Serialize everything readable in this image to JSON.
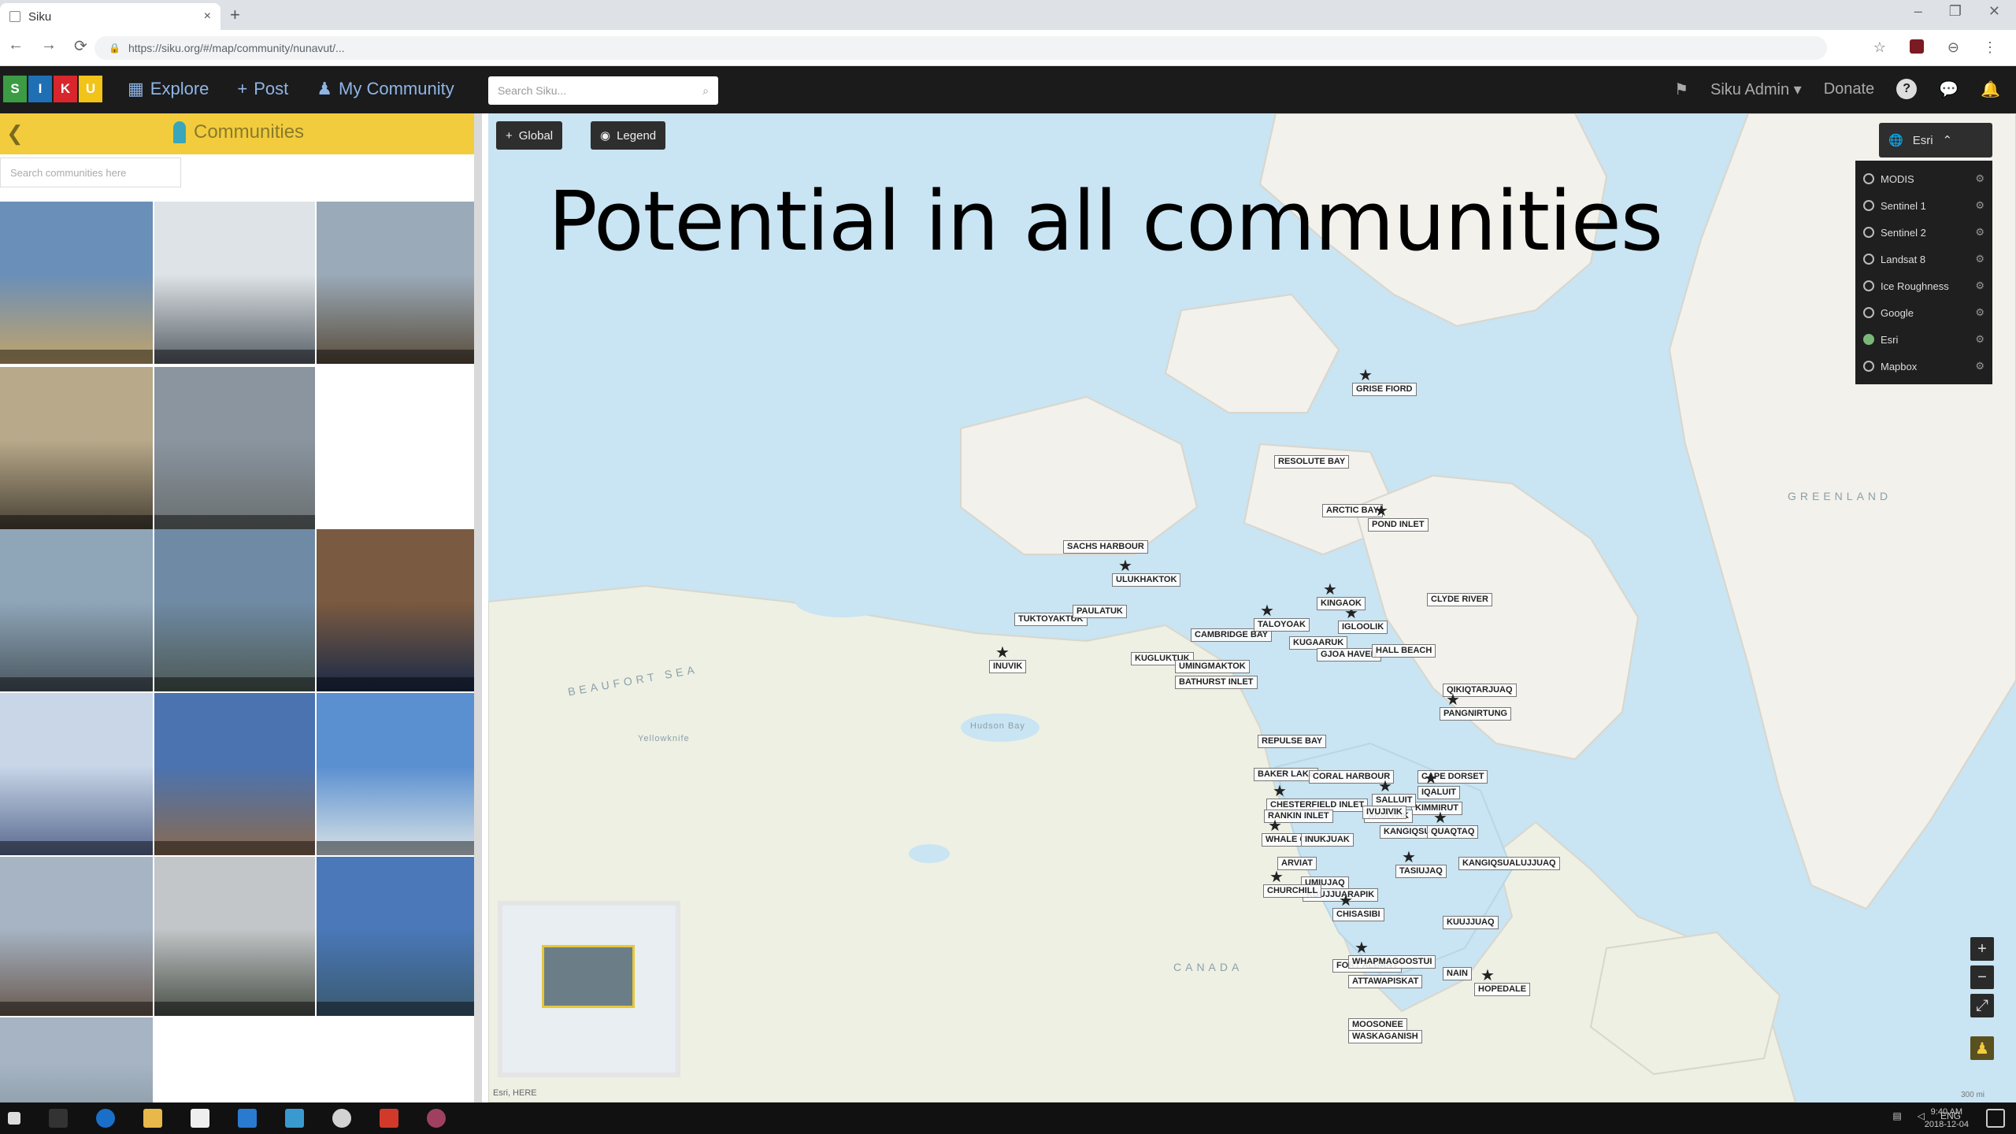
{
  "browser": {
    "tab_title": "Siku",
    "new_tab": "+",
    "tab_close": "×",
    "url": "https://siku.org/#/map/community/nunavut/...",
    "window_controls": [
      "–",
      "❐",
      "✕"
    ],
    "nav": [
      "←",
      "→",
      "⟳"
    ]
  },
  "app": {
    "logo_letters": [
      "S",
      "I",
      "K",
      "U"
    ],
    "logo_colors": [
      "#3b9c44",
      "#1f6fb5",
      "#d8262c",
      "#f2c318"
    ],
    "nav": [
      {
        "label": "Explore",
        "icon": "grid-icon"
      },
      {
        "label": "Post",
        "icon": "plus-icon"
      },
      {
        "label": "My Community",
        "icon": "person-icon"
      }
    ],
    "search_placeholder": "Search Siku...",
    "user": "Siku Admin",
    "donate": "Donate",
    "icons": [
      "help-icon",
      "chat-icon",
      "bell-icon"
    ]
  },
  "panel": {
    "title": "Communities",
    "back": "❮",
    "search_placeholder": "Search communities here",
    "tiles": [
      {
        "colors": [
          "#6a8fb8",
          "#c2a36a"
        ]
      },
      {
        "colors": [
          "#dde3e6",
          "#596068"
        ]
      },
      {
        "colors": [
          "#9aaab8",
          "#5a4d3c"
        ]
      },
      {
        "colors": [
          "#b8a98a",
          "#4a4236"
        ]
      },
      {
        "colors": [
          "#8a95a0",
          "#6a6f70"
        ]
      },
      {
        "colors": [
          "#ffffff",
          "#ffffff"
        ]
      },
      {
        "colors": [
          "#8fa5b8",
          "#4a5860"
        ]
      },
      {
        "colors": [
          "#6f8aa4",
          "#4d5a55"
        ]
      },
      {
        "colors": [
          "#7a5a40",
          "#1a2a48"
        ]
      },
      {
        "colors": [
          "#c8d6e8",
          "#5a6a90"
        ]
      },
      {
        "colors": [
          "#4a73b0",
          "#8a6a50"
        ]
      },
      {
        "colors": [
          "#5a8fd0",
          "#d8e2e6"
        ]
      },
      {
        "colors": [
          "#a6b4c4",
          "#6a5a50"
        ]
      },
      {
        "colors": [
          "#c2c6c8",
          "#4a5048"
        ]
      },
      {
        "colors": [
          "#4a78b8",
          "#3a5a70"
        ]
      },
      {
        "colors": [
          "#a6b4c4",
          "#8a9aa4"
        ]
      }
    ]
  },
  "map": {
    "title": "Potential in all communities",
    "filter_btn": "Global",
    "legend_btn": "Legend",
    "layers_btn": "Esri",
    "layers": [
      {
        "label": "MODIS",
        "on": false
      },
      {
        "label": "Sentinel 1",
        "on": false
      },
      {
        "label": "Sentinel 2",
        "on": false
      },
      {
        "label": "Landsat 8",
        "on": false
      },
      {
        "label": "Ice Roughness",
        "on": false
      },
      {
        "label": "Google",
        "on": false
      },
      {
        "label": "Esri",
        "on": true
      },
      {
        "label": "Mapbox",
        "on": false
      }
    ],
    "geo_labels": [
      "GREENLAND",
      "BEAUFORT SEA",
      "CANADA",
      "Yellowknife",
      "Hudson Bay"
    ],
    "communities": [
      "GRISE FIORD",
      "RESOLUTE BAY",
      "ARCTIC BAY",
      "POND INLET",
      "CLYDE RIVER",
      "SACHS HARBOUR",
      "ULUKHAKTOK",
      "TUKTOYAKTUK",
      "PAULATUK",
      "INUVIK",
      "KUGLUKTUK",
      "CAMBRIDGE BAY",
      "TALOYOAK",
      "KUGAARUK",
      "GJOA HAVEN",
      "IGLOOLIK",
      "HALL BEACH",
      "QIKIQTARJUAQ",
      "PANGNIRTUNG",
      "REPULSE BAY",
      "BAKER LAKE",
      "CHESTERFIELD INLET",
      "CORAL HARBOUR",
      "CAPE DORSET",
      "IQALUIT",
      "KIMMIRUT",
      "RANKIN INLET",
      "WHALE COVE",
      "ARVIAT",
      "AKULIVIK",
      "SALLUIT",
      "IVUJIVIK",
      "KANGIQSUJUAQ",
      "QUAQTAQ",
      "INUKJUAK",
      "KANGIQSUALUJJUAQ",
      "TASIUJAQ",
      "UMIUJAQ",
      "KUUJJUARAPIK",
      "CHISASIBI",
      "KUUJJUAQ",
      "NAIN",
      "HOPEDALE",
      "FORT ALBANY",
      "ATTAWAPISKAT",
      "WHAPMAGOOSTUI",
      "MOOSONEE",
      "WASKAGANISH",
      "CHURCHILL",
      "BATHURST INLET",
      "UMINGMAKTOK",
      "KINGAOK"
    ],
    "zoom": [
      "+",
      "−",
      "⤢",
      "♟"
    ],
    "attribution": "Esri, HERE",
    "scale": "300 mi"
  },
  "taskbar": {
    "clock": [
      "9:40 AM",
      "2018-12-04"
    ],
    "lang": "ENG"
  }
}
